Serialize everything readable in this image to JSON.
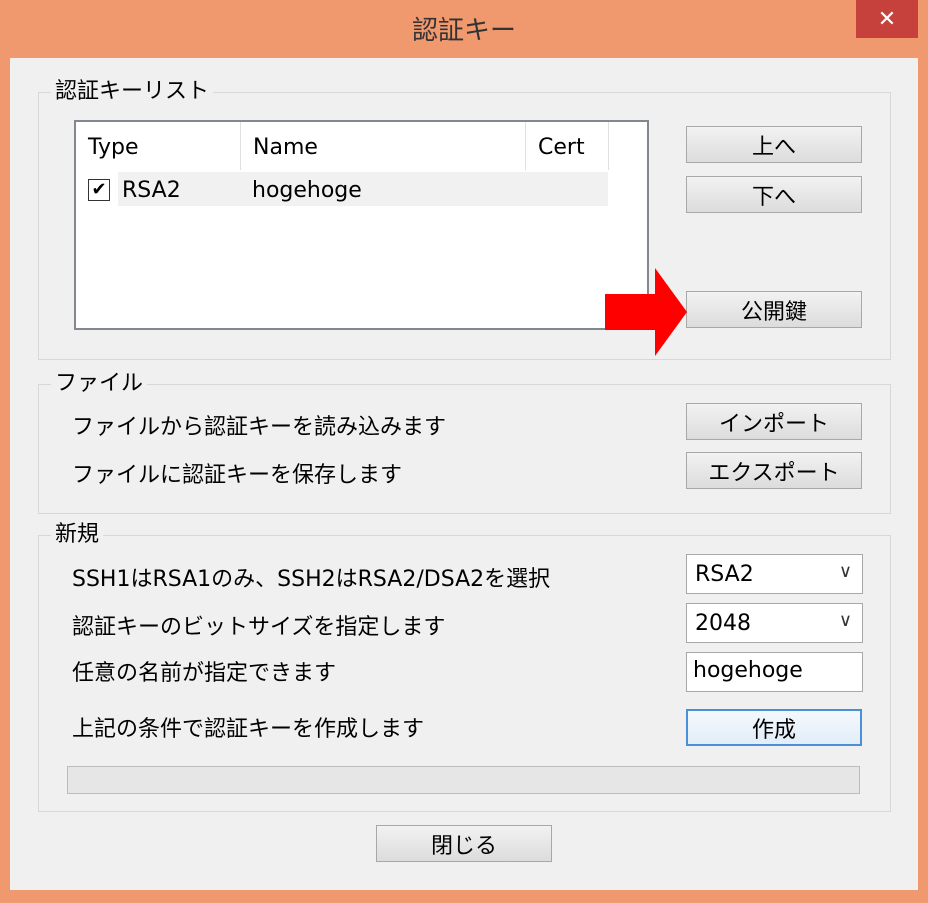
{
  "window": {
    "title": "認証キー",
    "close_glyph": "✕"
  },
  "key_list_group": {
    "title": "認証キーリスト",
    "columns": [
      "Type",
      "Name",
      "Cert"
    ],
    "rows": [
      {
        "checked": true,
        "check_glyph": "✔",
        "type": "RSA2",
        "name": "hogehoge",
        "cert": ""
      }
    ],
    "buttons": {
      "up": "上へ",
      "down": "下へ",
      "public_key": "公開鍵"
    }
  },
  "file_group": {
    "title": "ファイル",
    "import_desc": "ファイルから認証キーを読み込みます",
    "export_desc": "ファイルに認証キーを保存します",
    "import_button": "インポート",
    "export_button": "エクスポート"
  },
  "new_group": {
    "title": "新規",
    "type_desc": "SSH1はRSA1のみ、SSH2はRSA2/DSA2を選択",
    "type_value": "RSA2",
    "bits_desc": "認証キーのビットサイズを指定します",
    "bits_value": "2048",
    "name_desc": "任意の名前が指定できます",
    "name_value": "hogehoge",
    "create_desc": "上記の条件で認証キーを作成します",
    "create_button": "作成",
    "progress": 0
  },
  "close_button": "閉じる",
  "colors": {
    "title_bar": "#f0986e",
    "close_button": "#c7413c",
    "annotation_arrow": "#ff0000"
  }
}
